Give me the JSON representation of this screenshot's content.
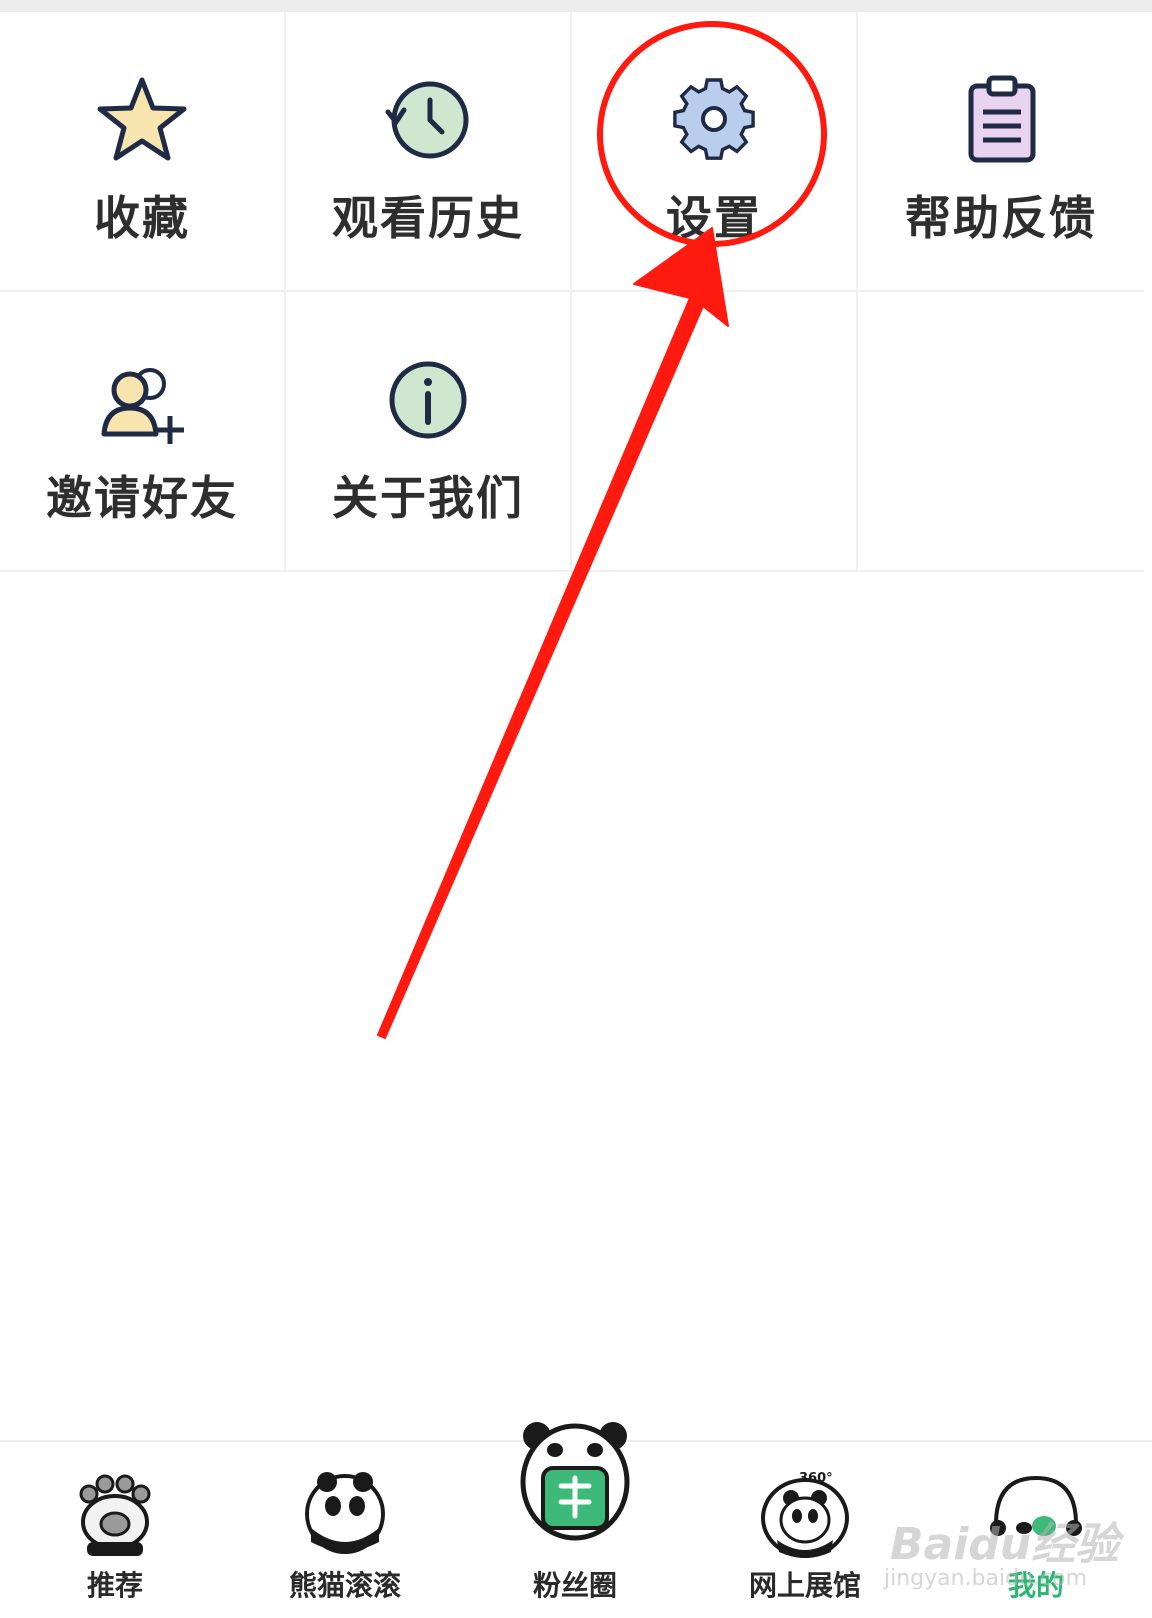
{
  "menu": {
    "items": [
      {
        "label": "收藏",
        "icon": "star-icon"
      },
      {
        "label": "观看历史",
        "icon": "history-clock-icon"
      },
      {
        "label": "设置",
        "icon": "gear-icon"
      },
      {
        "label": "帮助反馈",
        "icon": "clipboard-icon"
      },
      {
        "label": "邀请好友",
        "icon": "add-friend-icon"
      },
      {
        "label": "关于我们",
        "icon": "info-icon"
      }
    ]
  },
  "tabbar": {
    "tabs": [
      {
        "label": "推荐",
        "icon": "panda-paw-icon"
      },
      {
        "label": "熊猫滚滚",
        "icon": "rolling-panda-icon"
      },
      {
        "label": "粉丝圈",
        "icon": "panda-fan-circle-icon"
      },
      {
        "label": "网上展馆",
        "icon": "panda-360-icon"
      },
      {
        "label": "我的",
        "icon": "panda-profile-icon"
      }
    ],
    "active_index": 4,
    "active_color": "#2bb673"
  },
  "annotation": {
    "color": "#ff1a10"
  },
  "watermark": {
    "main": "Baidu经验",
    "sub": "jingyan.baidu.com"
  }
}
